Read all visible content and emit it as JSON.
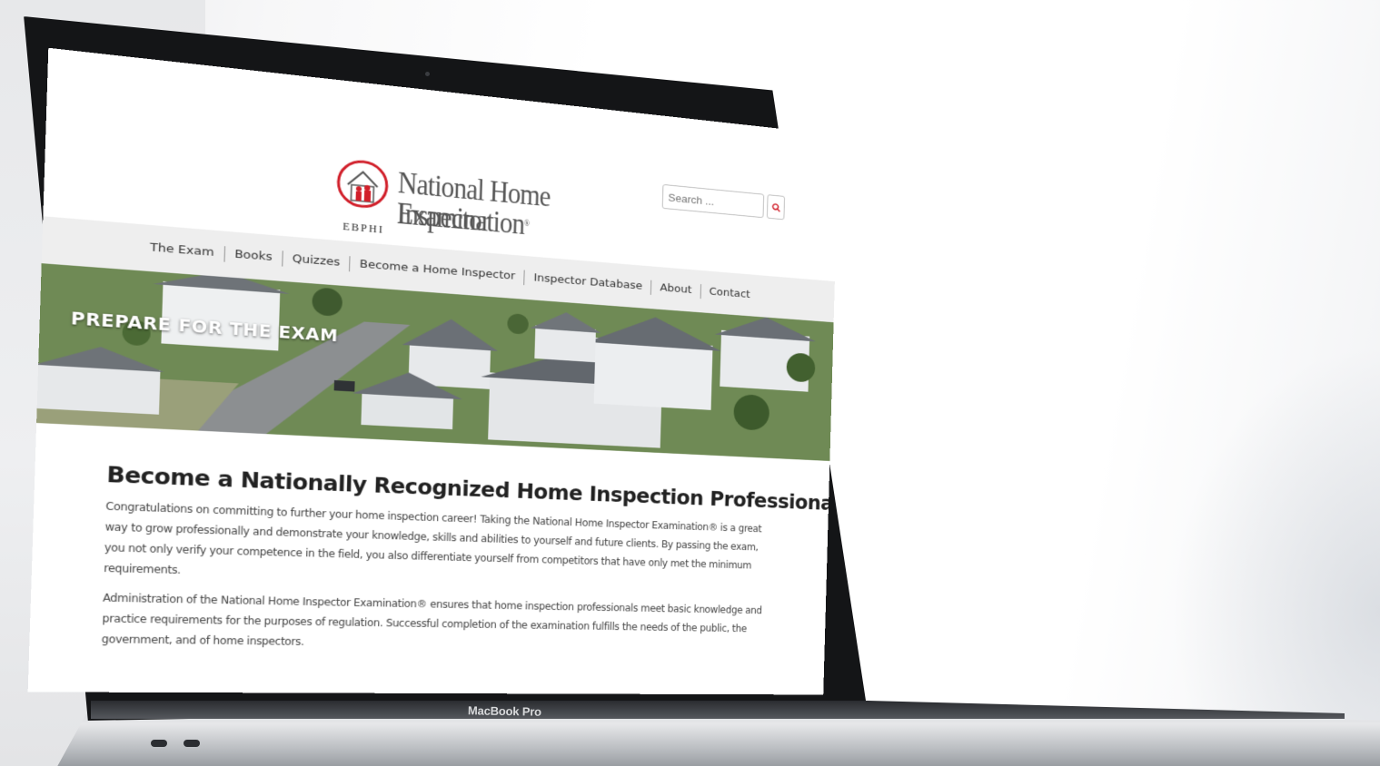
{
  "device": {
    "label": "MacBook Pro"
  },
  "site": {
    "logo": {
      "line1": "National Home Inspector",
      "line2": "Examination",
      "reg": "®",
      "org": "EBPHI"
    },
    "search": {
      "placeholder": "Search ..."
    },
    "nav": [
      {
        "label": "The Exam"
      },
      {
        "label": "Books"
      },
      {
        "label": "Quizzes"
      },
      {
        "label": "Become a Home Inspector"
      },
      {
        "label": "Inspector Database"
      },
      {
        "label": "About"
      },
      {
        "label": "Contact"
      }
    ],
    "hero": {
      "title": "PREPARE FOR THE EXAM"
    },
    "main": {
      "heading": "Become a Nationally Recognized Home Inspection Professional",
      "paragraphs": [
        "Congratulations on committing to further your home inspection career! Taking the National Home Inspector Examination® is a great way to grow professionally and demonstrate your knowledge, skills and abilities to yourself and future clients. By passing the exam, you not only verify your competence in the field, you also differentiate yourself from competitors that have only met the minimum requirements.",
        "Administration of the National Home Inspector Examination® ensures that home inspection professionals meet basic knowledge and practice requirements for the purposes of regulation. Successful completion of the examination fulfills the needs of the public, the government, and of home inspectors."
      ]
    },
    "colors": {
      "brand_red": "#d11f2a",
      "nav_bg": "#eeeeee",
      "text": "#444444"
    },
    "icons": {
      "search": "search-icon",
      "logo": "house-logo-icon"
    }
  }
}
